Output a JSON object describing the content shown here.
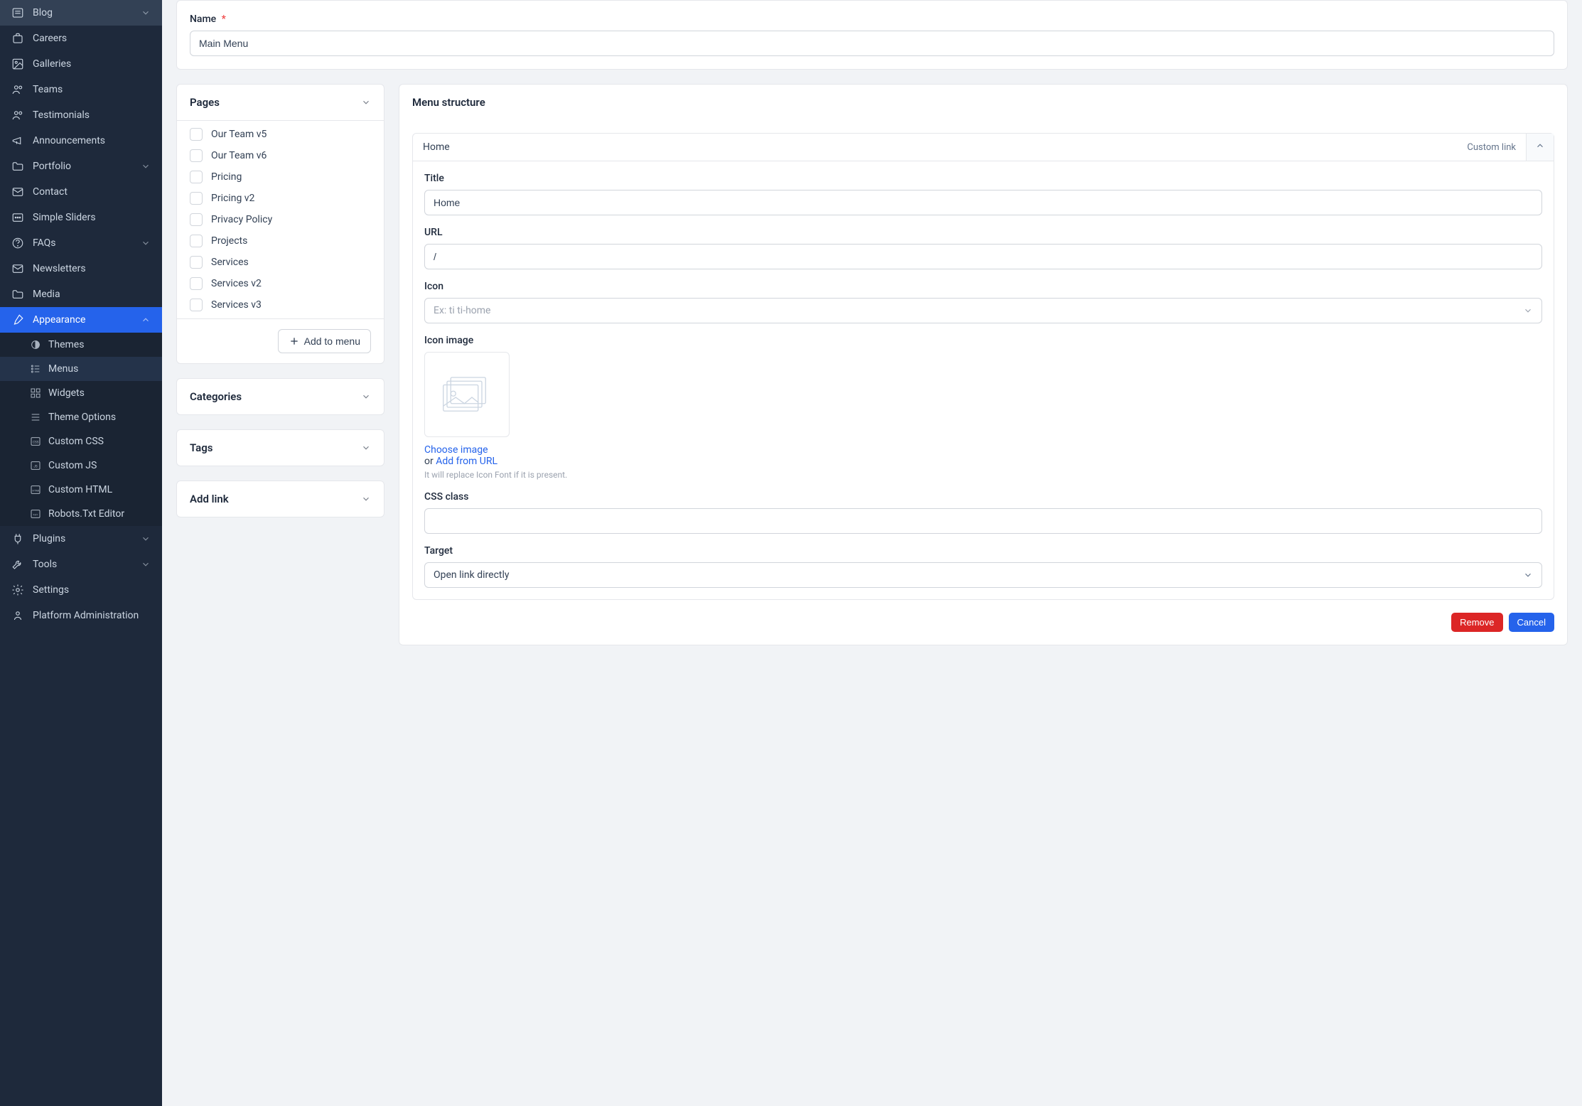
{
  "sidebar": {
    "items": [
      {
        "icon": "blog",
        "label": "Blog",
        "chevron": "down"
      },
      {
        "icon": "careers",
        "label": "Careers"
      },
      {
        "icon": "galleries",
        "label": "Galleries"
      },
      {
        "icon": "users",
        "label": "Teams"
      },
      {
        "icon": "users",
        "label": "Testimonials"
      },
      {
        "icon": "megaphone",
        "label": "Announcements"
      },
      {
        "icon": "folder",
        "label": "Portfolio",
        "chevron": "down"
      },
      {
        "icon": "mail",
        "label": "Contact"
      },
      {
        "icon": "sliders",
        "label": "Simple Sliders"
      },
      {
        "icon": "faq",
        "label": "FAQs",
        "chevron": "down"
      },
      {
        "icon": "mail",
        "label": "Newsletters"
      },
      {
        "icon": "folder",
        "label": "Media"
      },
      {
        "icon": "brush",
        "label": "Appearance",
        "chevron": "up",
        "active": true
      },
      {
        "sub": true,
        "icon": "theme",
        "label": "Themes"
      },
      {
        "sub": true,
        "icon": "menu",
        "label": "Menus",
        "selected": true
      },
      {
        "sub": true,
        "icon": "widgets",
        "label": "Widgets"
      },
      {
        "sub": true,
        "icon": "options",
        "label": "Theme Options"
      },
      {
        "sub": true,
        "icon": "css",
        "label": "Custom CSS"
      },
      {
        "sub": true,
        "icon": "js",
        "label": "Custom JS"
      },
      {
        "sub": true,
        "icon": "html",
        "label": "Custom HTML"
      },
      {
        "sub": true,
        "icon": "robots",
        "label": "Robots.Txt Editor"
      },
      {
        "icon": "plugins",
        "label": "Plugins",
        "chevron": "down"
      },
      {
        "icon": "tools",
        "label": "Tools",
        "chevron": "down"
      },
      {
        "icon": "settings",
        "label": "Settings"
      },
      {
        "icon": "admin",
        "label": "Platform Administration"
      }
    ]
  },
  "form": {
    "name_label": "Name",
    "name_value": "Main Menu"
  },
  "pages": {
    "header": "Pages",
    "items": [
      "Our Team v5",
      "Our Team v6",
      "Pricing",
      "Pricing v2",
      "Privacy Policy",
      "Projects",
      "Services",
      "Services v2",
      "Services v3"
    ],
    "add_button": "Add to menu"
  },
  "categories_header": "Categories",
  "tags_header": "Tags",
  "addlink_header": "Add link",
  "menu_structure": {
    "header": "Menu structure",
    "item": {
      "name": "Home",
      "type": "Custom link",
      "title_label": "Title",
      "title_value": "Home",
      "url_label": "URL",
      "url_value": "/",
      "icon_label": "Icon",
      "icon_placeholder": "Ex: ti ti-home",
      "icon_image_label": "Icon image",
      "choose_image": "Choose image",
      "or_text": "or ",
      "add_from_url": "Add from URL",
      "image_help": "It will replace Icon Font if it is present.",
      "css_label": "CSS class",
      "css_value": "",
      "target_label": "Target",
      "target_value": "Open link directly",
      "remove": "Remove",
      "cancel": "Cancel"
    }
  }
}
